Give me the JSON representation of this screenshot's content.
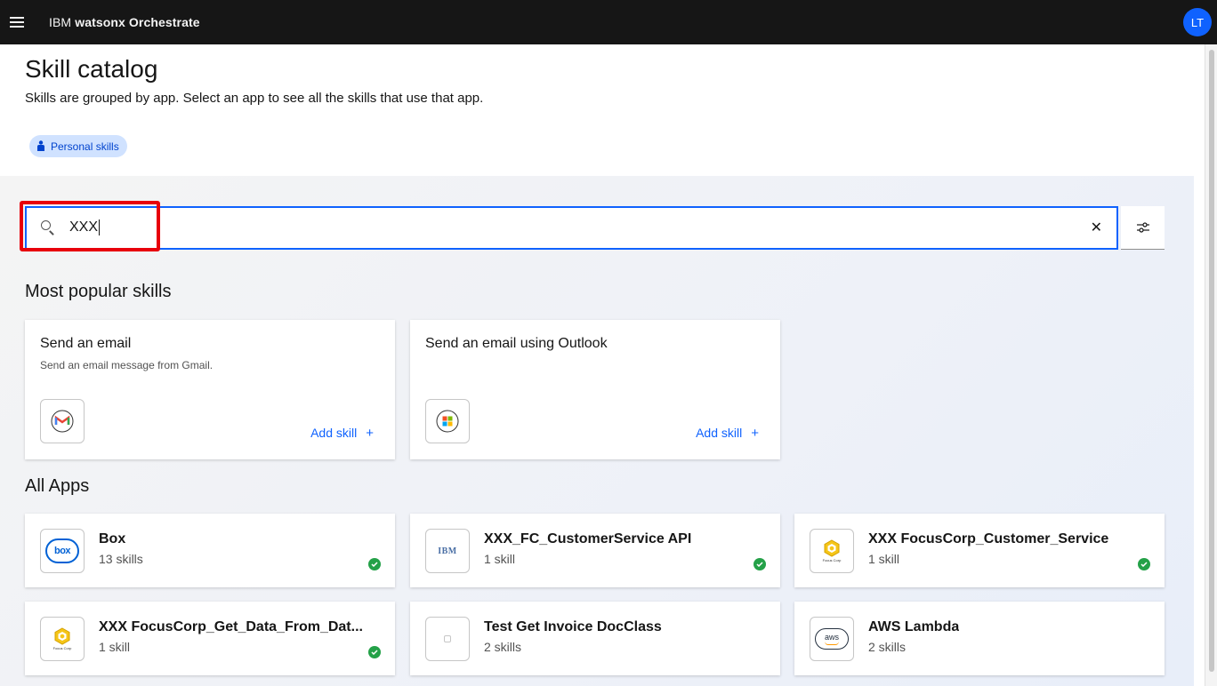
{
  "app": {
    "brand_prefix": "IBM",
    "brand_name": "watsonx Orchestrate",
    "avatar_initials": "LT"
  },
  "header": {
    "title": "Skill catalog",
    "subtitle": "Skills are grouped by app. Select an app to see all the skills that use that app.",
    "tag_label": "Personal skills"
  },
  "search": {
    "value": "XXX",
    "clear_icon": "close-icon",
    "filter_icon": "settings-adjust-icon"
  },
  "popular": {
    "section_title": "Most popular skills",
    "cards": [
      {
        "title": "Send an email",
        "description": "Send an email message from Gmail.",
        "action": "Add skill",
        "logo": "gmail-logo"
      },
      {
        "title": "Send an email using Outlook",
        "description": "",
        "action": "Add skill",
        "logo": "microsoft-logo"
      }
    ]
  },
  "apps": {
    "section_title": "All Apps",
    "items": [
      {
        "name": "Box",
        "count": "13 skills",
        "added": true,
        "logo": "box-logo",
        "logo_text": "box"
      },
      {
        "name": "XXX_FC_CustomerService API",
        "count": "1 skill",
        "added": true,
        "logo": "ibm-logo",
        "logo_text": "IBM"
      },
      {
        "name": "XXX FocusCorp_Customer_Service",
        "count": "1 skill",
        "added": true,
        "logo": "focuscorp-logo"
      },
      {
        "name": "XXX FocusCorp_Get_Data_From_Dat...",
        "count": "1 skill",
        "added": true,
        "logo": "focuscorp-logo"
      },
      {
        "name": "Test Get Invoice DocClass",
        "count": "2 skills",
        "added": false,
        "logo": "placeholder-logo"
      },
      {
        "name": "AWS Lambda",
        "count": "2 skills",
        "added": false,
        "logo": "aws-logo",
        "logo_text": "aws"
      }
    ]
  },
  "colors": {
    "accent": "#0f62fe",
    "highlight": "#e8000b",
    "success": "#24a148"
  }
}
